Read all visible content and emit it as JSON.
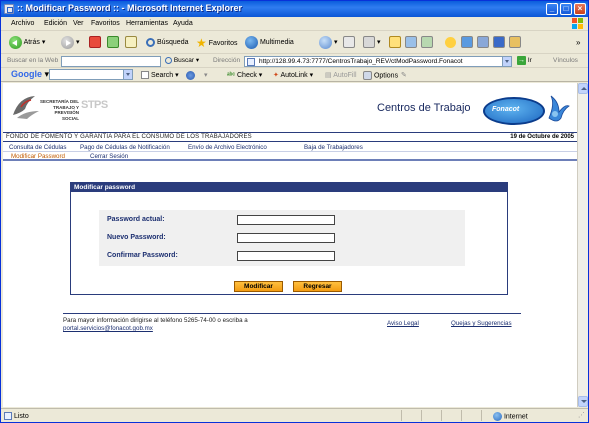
{
  "window": {
    "title": ":: Modificar Password :: - Microsoft Internet Explorer"
  },
  "menu": {
    "items": [
      "Archivo",
      "Edición",
      "Ver",
      "Favoritos",
      "Herramientas",
      "Ayuda"
    ]
  },
  "toolbar": {
    "back_label": "Atrás",
    "search_label": "Búsqueda",
    "favorites_label": "Favoritos",
    "multimedia_label": "Multimedia"
  },
  "address_bar": {
    "search_web_label": "Buscar en la Web",
    "search_button": "Buscar",
    "address_label": "Dirección",
    "url": "http://128.99.4.73:7777/CentrosTrabajo_REV/ctModPassword.Fonacot",
    "go_label": "Ir",
    "links_label": "Vínculos"
  },
  "google_bar": {
    "brand": "Google",
    "search_label": "Search",
    "check_label": "Check",
    "autolink_label": "AutoLink",
    "autofill_label": "AutoFill",
    "options_label": "Options"
  },
  "page": {
    "logo_text": [
      "SECRETARÍA DEL",
      "TRABAJO Y",
      "PREVISIÓN SOCIAL"
    ],
    "logo_abbr": "STPS",
    "site_title": "Centros de Trabajo",
    "fonacot_logo": "Fonacot",
    "org_name": "FONDO DE FOMENTO Y GARANTIA PARA EL CONSUMO DE LOS TRABAJADORES",
    "date": "19 de Octubre de 2005",
    "nav": {
      "row1": [
        "Consulta de Cédulas",
        "Pago de Cédulas de Notificación",
        "Envío de Archivo Electrónico",
        "Baja de Trabajadores"
      ],
      "row2": [
        "Modificar Password",
        "Cerrar Sesión"
      ]
    },
    "form": {
      "header": "Modificar password",
      "current_label": "Password actual:",
      "new_label": "Nuevo Password:",
      "confirm_label": "Confirmar Password:",
      "current_value": "",
      "new_value": "",
      "confirm_value": "",
      "submit_label": "Modificar",
      "back_label": "Regresar"
    },
    "footer": {
      "info_line1": "Para mayor información dirigirse al teléfono 5265-74-00 o escriba a",
      "email": "portal.servicios@fonacot.gob.mx",
      "legal_link": "Aviso Legal",
      "complaints_link": "Quejas y Sugerencias"
    }
  },
  "status_bar": {
    "status": "Listo",
    "zone": "Internet"
  }
}
